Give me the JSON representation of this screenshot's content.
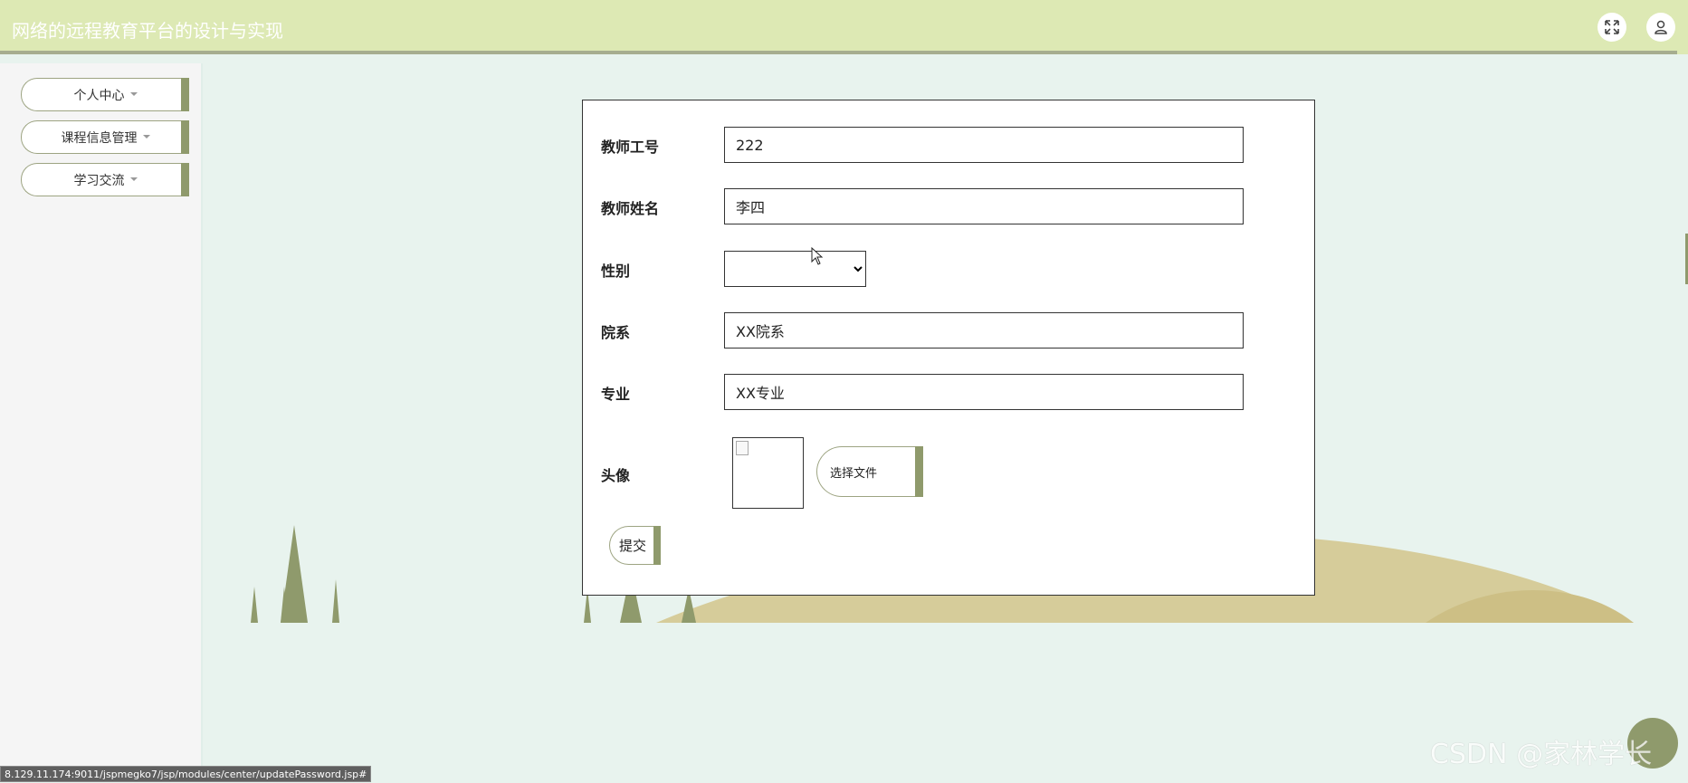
{
  "header": {
    "title": "网络的远程教育平台的设计与实现",
    "fullscreen_icon": "expand-icon",
    "user_icon": "user-icon"
  },
  "sidebar": {
    "items": [
      {
        "label": "个人中心"
      },
      {
        "label": "课程信息管理"
      },
      {
        "label": "学习交流"
      }
    ]
  },
  "form": {
    "fields": [
      {
        "label": "教师工号",
        "value": "222"
      },
      {
        "label": "教师姓名",
        "value": "李四"
      },
      {
        "label": "性别",
        "value": ""
      },
      {
        "label": "院系",
        "value": "XX院系"
      },
      {
        "label": "专业",
        "value": "XX专业"
      }
    ],
    "avatar_label": "头像",
    "file_button": "选择文件",
    "submit": "提交"
  },
  "status": {
    "url": "8.129.11.174:9011/jspmegko7/jsp/modules/center/updatePassword.jsp#"
  },
  "watermark": "CSDN @家林学长",
  "colors": {
    "header_bg": "#dde9b4",
    "accent": "#8f9a6c",
    "page_bg": "#e8f3ee",
    "sand": "#d6cc9a"
  }
}
